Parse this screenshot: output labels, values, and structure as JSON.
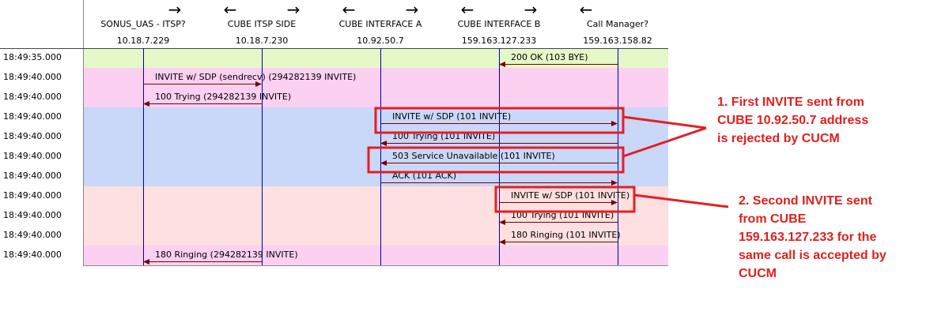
{
  "participants": [
    {
      "name": "SONUS_UAS - ITSP?",
      "ip": "10.18.7.229",
      "arrow": ""
    },
    {
      "name": "CUBE ITSP SIDE",
      "ip": "10.18.7.230",
      "arrow": "←→"
    },
    {
      "name": "CUBE INTERFACE A",
      "ip": "10.92.50.7",
      "arrow": "←→"
    },
    {
      "name": "CUBE INTERFACE B",
      "ip": "159.163.127.233",
      "arrow": "←→"
    },
    {
      "name": "Call Manager?",
      "ip": "159.163.158.82",
      "arrow": "←"
    }
  ],
  "messages": [
    {
      "time": "18:49:35.000",
      "from": 4,
      "to": 3,
      "label": "200 OK (103 BYE)",
      "bg": "#e4f8c8"
    },
    {
      "time": "18:49:40.000",
      "from": 0,
      "to": 1,
      "label": "INVITE w/ SDP (sendrecv)  (294282139 INVITE)",
      "bg": "#fbd0f1"
    },
    {
      "time": "18:49:40.000",
      "from": 1,
      "to": 0,
      "label": "100 Trying (294282139 INVITE)",
      "bg": "#fbd0f1"
    },
    {
      "time": "18:49:40.000",
      "from": 2,
      "to": 4,
      "label": "INVITE w/ SDP (101 INVITE)",
      "bg": "#c9d7f8"
    },
    {
      "time": "18:49:40.000",
      "from": 4,
      "to": 2,
      "label": "100 Trying (101 INVITE)",
      "bg": "#c9d7f8"
    },
    {
      "time": "18:49:40.000",
      "from": 4,
      "to": 2,
      "label": "503 Service Unavailable (101 INVITE)",
      "bg": "#c9d7f8"
    },
    {
      "time": "18:49:40.000",
      "from": 2,
      "to": 4,
      "label": "ACK (101 ACK)",
      "bg": "#c9d7f8"
    },
    {
      "time": "18:49:40.000",
      "from": 3,
      "to": 4,
      "label": "INVITE w/ SDP (101 INVITE)",
      "bg": "#fde0df"
    },
    {
      "time": "18:49:40.000",
      "from": 4,
      "to": 3,
      "label": "100 Trying (101 INVITE)",
      "bg": "#fde0df"
    },
    {
      "time": "18:49:40.000",
      "from": 4,
      "to": 3,
      "label": "180 Ringing (101 INVITE)",
      "bg": "#fde0df"
    },
    {
      "time": "18:49:40.000",
      "from": 1,
      "to": 0,
      "label": "180 Ringing (294282139 INVITE)",
      "bg": "#fbd0f1"
    }
  ],
  "highlights": [
    3,
    5,
    7
  ],
  "annotations": [
    {
      "lines": [
        "1. First INVITE sent from",
        "CUBE 10.92.50.7 address",
        "is rejected by CUCM"
      ],
      "targets": [
        3,
        5
      ]
    },
    {
      "lines": [
        "2. Second INVITE sent",
        "from CUBE",
        "159.163.127.233 for the",
        "same call is accepted by",
        "CUCM"
      ],
      "targets": [
        7
      ]
    }
  ],
  "colors": {
    "lifeline": "#0000b8",
    "arrow": "#7a0000",
    "highlight": "#e41f24",
    "text": "#000000"
  }
}
